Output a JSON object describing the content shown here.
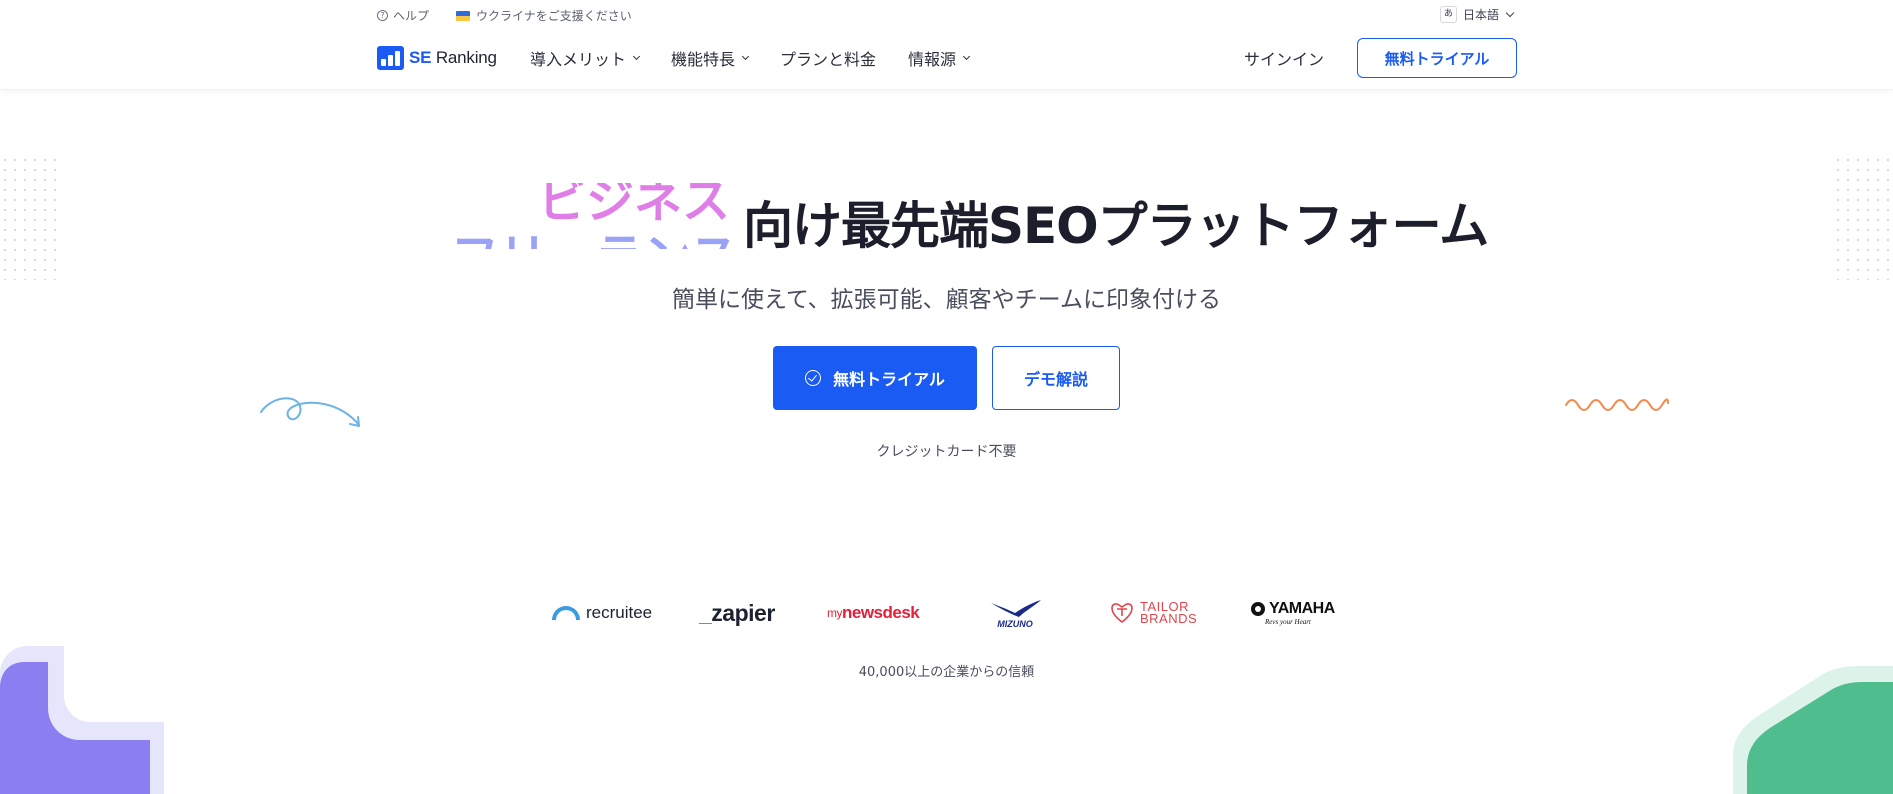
{
  "topbar": {
    "help_label": "ヘルプ",
    "help_icon": "question-circle-icon",
    "ukraine_label": "ウクライナをご支援ください",
    "lang_icon_char": "あ",
    "language_label": "日本語"
  },
  "header": {
    "logo_se": "SE",
    "logo_ranking": "Ranking",
    "nav": [
      {
        "label": "導入メリット",
        "dropdown": true
      },
      {
        "label": "機能特長",
        "dropdown": true
      },
      {
        "label": "プランと料金",
        "dropdown": false
      },
      {
        "label": "情報源",
        "dropdown": true
      }
    ],
    "signin_label": "サインイン",
    "trial_label": "無料トライアル"
  },
  "hero": {
    "rotating_words": [
      "ビジネス",
      "フリーランス"
    ],
    "headline": "向け最先端SEOプラットフォーム",
    "subtitle": "簡単に使えて、拡張可能、顧客やチームに印象付ける",
    "primary_cta": "無料トライアル",
    "secondary_cta": "デモ解説",
    "no_card_note": "クレジットカード不要"
  },
  "logos": {
    "recruitee": "recruitee",
    "zapier": "zapier",
    "mynewsdesk_my": "my",
    "mynewsdesk_rest": "newsdesk",
    "mizuno": "MIZUNO",
    "tailor_1": "TAILOR",
    "tailor_2": "BRANDS",
    "yamaha": "YAMAHA",
    "yamaha_tagline": "Revs your Heart"
  },
  "trusted_note": "40,000以上の企業からの信頼",
  "colors": {
    "brand_blue": "#1a5bf4",
    "headline_text": "#1c1f2b",
    "rotator_pink": "#e07ee8",
    "rotator_violet": "#9aa2f8",
    "deco_orange": "#f5894a",
    "deco_blue": "#6ab4e6"
  }
}
